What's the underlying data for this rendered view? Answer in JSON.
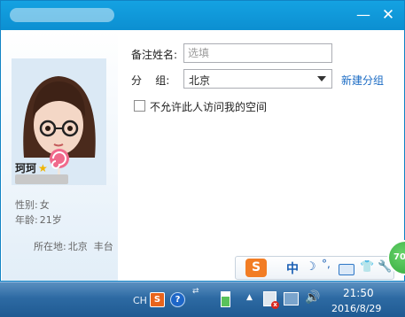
{
  "window": {
    "minimize_icon": "minimize-icon",
    "close_icon": "close-icon",
    "minimize_glyph": "—",
    "close_glyph": "✕"
  },
  "profile": {
    "nickname": "珂珂",
    "star_glyph": "★",
    "gender_label": "性别:",
    "gender": "女",
    "age_label": "年龄:",
    "age": "21岁",
    "location_label": "所在地:",
    "location": "北京  丰台"
  },
  "form": {
    "remark_label": "备注姓名:",
    "remark_placeholder": "选填",
    "remark_value": "",
    "group_label": "分    组:",
    "group_value": "北京",
    "new_group_link": "新建分组",
    "deny_access_label": "不允许此人访问我的空间",
    "deny_access_checked": false
  },
  "ime_toolbar": {
    "logo": "S",
    "mode": "中",
    "moon": "☽",
    "punct": "°,",
    "shirt": "👕",
    "wrench": "🔧"
  },
  "badge": {
    "text": "70"
  },
  "taskbar": {
    "lang": "CH",
    "sogou": "S",
    "help": "?",
    "display_glyph": "⇄",
    "caret": "▲",
    "speaker": "🔊",
    "net_x": "x",
    "time": "21:50",
    "date": "2016/8/29"
  },
  "colors": {
    "titlebar": "#14a2e2",
    "link": "#1a6bc4",
    "taskbar": "#2d6aa3",
    "ime_logo": "#f27d24",
    "badge": "#2ea73a"
  }
}
